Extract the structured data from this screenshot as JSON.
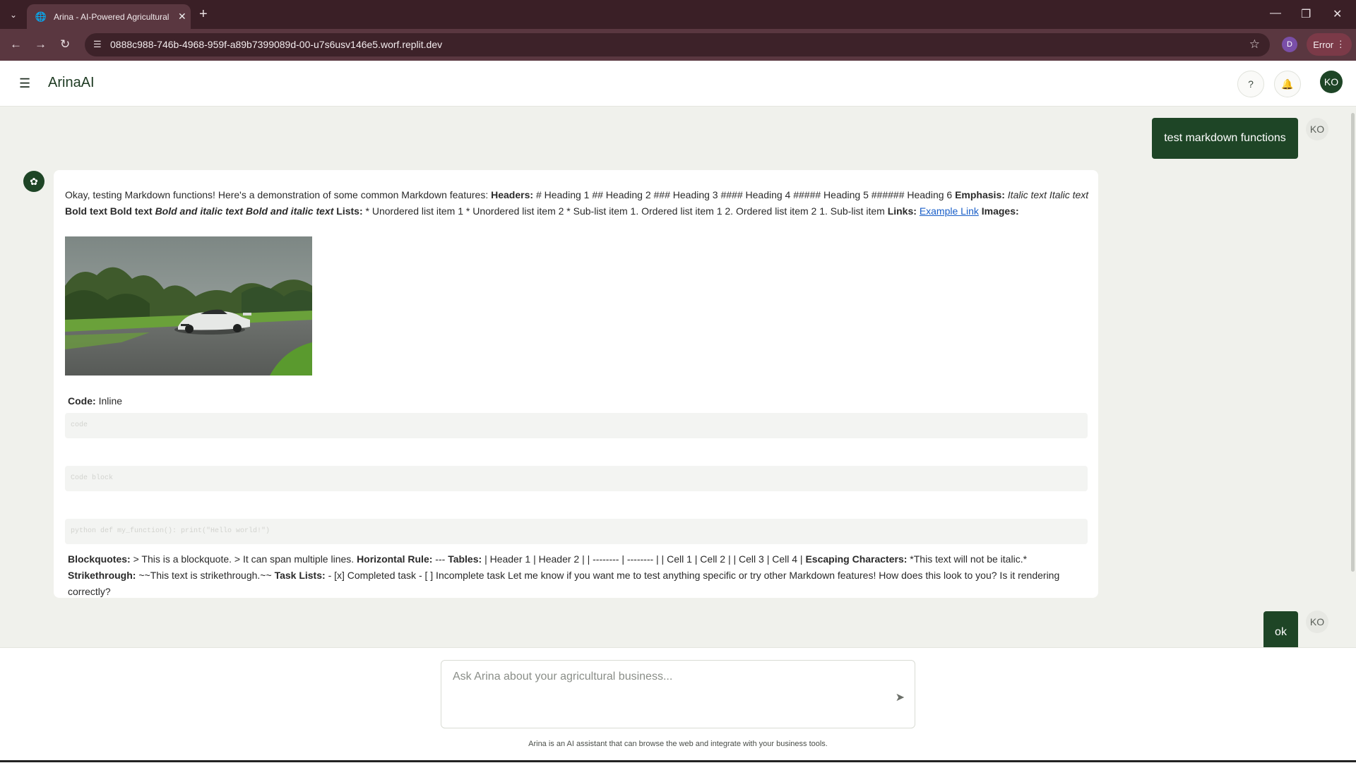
{
  "browser": {
    "tab_title": "Arina - AI-Powered Agricultural",
    "url": "0888c988-746b-4968-959f-a89b7399089d-00-u7s6usv146e5.worf.replit.dev",
    "profile_initial": "D",
    "error_label": "Error"
  },
  "header": {
    "brand": "ArinaAI",
    "user_initials": "KO"
  },
  "chat": {
    "msg1": {
      "text": "test markdown functions",
      "avatar": "KO"
    },
    "ai": {
      "intro": "Okay, testing Markdown functions! Here's a demonstration of some common Markdown features:",
      "headers_label": "Headers:",
      "headers_text": "# Heading 1 ## Heading 2 ### Heading 3 #### Heading 4 ##### Heading 5 ###### Heading 6",
      "emphasis_label": "Emphasis:",
      "italic_text": "Italic text Italic text",
      "bold_text": "Bold text Bold text",
      "bold_italic_text": "Bold and italic text Bold and italic text",
      "lists_label": "Lists:",
      "lists_text": "* Unordered list item 1 * Unordered list item 2 * Sub-list item 1. Ordered list item 1 2. Ordered list item 2 1. Sub-list item",
      "links_label": "Links:",
      "link_text": "Example Link",
      "images_label": "Images:",
      "code_label": "Code:",
      "code_text": "Inline",
      "code_box1": "code",
      "code_box2": "Code block",
      "code_box3": "python def my_function(): print(\"Hello world!\")",
      "blockquotes_label": "Blockquotes:",
      "blockquotes_text": "> This is a blockquote. > It can span multiple lines.",
      "hr_label": "Horizontal Rule:",
      "hr_text": "---",
      "tables_label": "Tables:",
      "tables_text": "| Header 1 | Header 2 | | -------- | -------- | | Cell 1 | Cell 2 | | Cell 3 | Cell 4 |",
      "escaping_label": "Escaping Characters:",
      "escaping_text": "*This text will not be italic.*",
      "strike_label": "Strikethrough:",
      "strike_text": "~~This text is strikethrough.~~",
      "tasks_label": "Task Lists:",
      "tasks_text": "- [x] Completed task - [ ] Incomplete task Let me know if you want me to test anything specific or try other Markdown features! How does this look to you? Is it rendering correctly?"
    },
    "msg2": {
      "text": "ok",
      "avatar": "KO"
    }
  },
  "composer": {
    "placeholder": "Ask Arina about your agricultural business...",
    "footnote": "Arina is an AI assistant that can browse the web and integrate with your business tools."
  },
  "icons": {
    "tab_list": "chevron-down-icon",
    "favicon": "globe-icon",
    "back": "arrow-left-icon",
    "forward": "arrow-right-icon",
    "reload": "reload-icon",
    "site_info": "tune-icon",
    "bookmark": "star-icon",
    "menu": "hamburger-icon",
    "help": "help-icon",
    "notifications": "bell-icon",
    "assistant": "sprout-icon",
    "send": "send-icon"
  },
  "colors": {
    "brand_green": "#1e4526",
    "background": "#f0f1ec",
    "browser_frame": "#3a1f26",
    "link": "#1a5fc8"
  }
}
